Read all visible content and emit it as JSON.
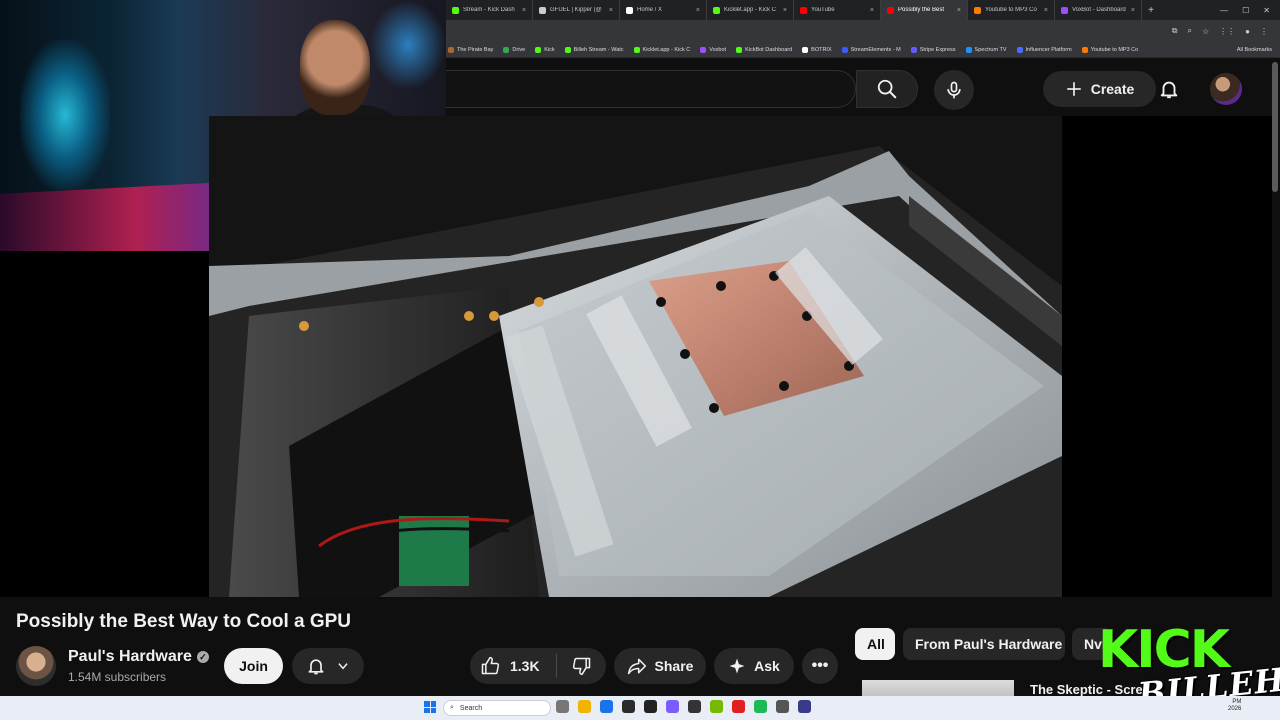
{
  "browser": {
    "tabs": [
      {
        "label": "Stream - Kick Dash",
        "color": "#53fc18",
        "active": false
      },
      {
        "label": "GFUEL | Kipper (@",
        "color": "#cccccc",
        "active": false
      },
      {
        "label": "Home / X",
        "color": "#ffffff",
        "active": false
      },
      {
        "label": "Kicklet.app - Kick C",
        "color": "#53fc18",
        "active": false
      },
      {
        "label": "YouTube",
        "color": "#ff0000",
        "active": false
      },
      {
        "label": "Possibly the Best",
        "color": "#ff0000",
        "active": true
      },
      {
        "label": "Youtube to MP3 Co",
        "color": "#ff7a00",
        "active": false
      },
      {
        "label": "VoxBot - Dashboard",
        "color": "#a04cff",
        "active": false
      }
    ],
    "new_tab_glyph": "+",
    "window_controls": [
      "—",
      "☐",
      "✕"
    ],
    "bookmarks": [
      {
        "label": "The Pirate Bay",
        "color": "#aa6633"
      },
      {
        "label": "Drive",
        "color": "#34a853"
      },
      {
        "label": "Kick",
        "color": "#53fc18"
      },
      {
        "label": "Billeh Stream - Watc",
        "color": "#53fc18"
      },
      {
        "label": "Kicklet.app - Kick C",
        "color": "#53fc18"
      },
      {
        "label": "Voxbot",
        "color": "#a04cff"
      },
      {
        "label": "KickBot Dashboard",
        "color": "#53fc18"
      },
      {
        "label": "BOTRIX",
        "color": "#ffffff"
      },
      {
        "label": "StreamElements - M",
        "color": "#3b5bff"
      },
      {
        "label": "Stripe Express",
        "color": "#635bff"
      },
      {
        "label": "Spectrum TV",
        "color": "#1e90ff"
      },
      {
        "label": "Influencer Platform",
        "color": "#4a6cff"
      },
      {
        "label": "Youtube to MP3 Co",
        "color": "#ff7a00"
      }
    ],
    "all_bookmarks": "All Bookmarks"
  },
  "masthead": {
    "create_label": "Create"
  },
  "video": {
    "title": "Possibly the Best Way to Cool a GPU"
  },
  "channel": {
    "name": "Paul's Hardware",
    "subscribers": "1.54M subscribers",
    "join_label": "Join"
  },
  "actions": {
    "like_count": "1.3K",
    "share_label": "Share",
    "ask_label": "Ask",
    "more_glyph": "•••"
  },
  "chips": [
    {
      "label": "All",
      "active": true
    },
    {
      "label": "From Paul's Hardware",
      "active": false
    },
    {
      "label": "Nvi",
      "active": false
    }
  ],
  "next_video": {
    "title": "The Skeptic - Screa"
  },
  "overlay": {
    "kick_word": "KICK",
    "kick_sub": "BILLEH"
  },
  "taskbar": {
    "search_placeholder": "Search",
    "apps": [
      "#777777",
      "#f2b400",
      "#1a73e8",
      "#2b2b2b",
      "#222222",
      "#7b5cff",
      "#333333",
      "#76b900",
      "#e02020",
      "#1db954",
      "#555555",
      "#3a3a8a"
    ],
    "time": "PM",
    "date": "2026"
  }
}
